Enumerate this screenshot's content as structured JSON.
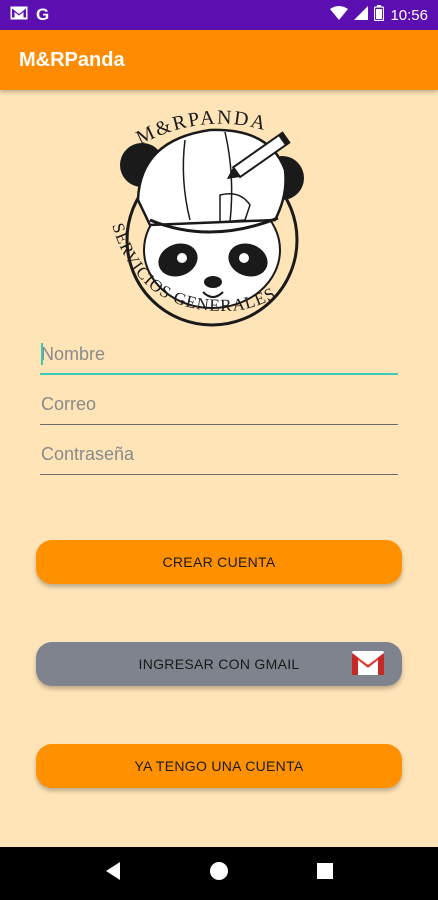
{
  "status_bar": {
    "time": "10:56",
    "g_letter": "G",
    "icons": [
      "gmail-notification-icon",
      "google-icon",
      "wifi-icon",
      "cellular-signal-icon",
      "battery-icon"
    ]
  },
  "app_bar": {
    "title": "M&RPanda"
  },
  "logo": {
    "top_text": "M&RPANDA",
    "bottom_text": "SERVICIOS GENERALES"
  },
  "form": {
    "name_placeholder": "Nombre",
    "email_placeholder": "Correo",
    "password_placeholder": "Contraseña"
  },
  "buttons": {
    "create_account": "CREAR CUENTA",
    "gmail_login": "INGRESAR CON GMAIL",
    "have_account": "YA TENGO UNA CUENTA"
  },
  "colors": {
    "status_bar": "#5C0FB0",
    "app_bar": "#FF8C00",
    "background": "#FFE4B8",
    "button_orange": "#FF9100",
    "button_gray": "#7E838D",
    "focus_accent": "#39C9B5"
  },
  "nav_bar": {
    "icons": [
      "back-icon",
      "home-icon",
      "recents-icon"
    ]
  }
}
